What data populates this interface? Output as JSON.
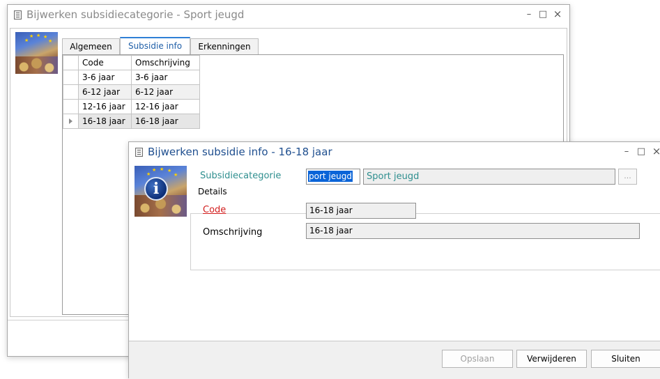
{
  "back_window": {
    "title": "Bijwerken subsidiecategorie - Sport jeugd",
    "tabs": [
      {
        "label": "Algemeen"
      },
      {
        "label": "Subsidie info"
      },
      {
        "label": "Erkenningen"
      }
    ],
    "grid": {
      "headers": [
        "Code",
        "Omschrijving"
      ],
      "rows": [
        {
          "code": "3-6 jaar",
          "omschrijving": "3-6 jaar"
        },
        {
          "code": "6-12 jaar",
          "omschrijving": "6-12 jaar"
        },
        {
          "code": "12-16 jaar",
          "omschrijving": "12-16 jaar"
        },
        {
          "code": "16-18 jaar",
          "omschrijving": "16-18 jaar"
        }
      ]
    }
  },
  "front_window": {
    "title": "Bijwerken subsidie info - 16-18 jaar",
    "subsidiecategorie_label": "Subsidiecategorie",
    "subsidiecategorie_code": "port jeugd",
    "subsidiecategorie_name": "Sport jeugd",
    "ellipsis": "...",
    "details_label": "Details",
    "code_label": "Code",
    "code_value": "16-18 jaar",
    "omschrijving_label": "Omschrijving",
    "omschrijving_value": "16-18 jaar",
    "buttons": {
      "save": "Opslaan",
      "delete": "Verwijderen",
      "close": "Sluiten"
    }
  },
  "window_controls": {
    "minimize": "–",
    "maximize": "□",
    "close": "×"
  },
  "colors": {
    "accent": "#2f7fd6",
    "teal_label": "#2f8f8f",
    "required_link": "#d21e1e",
    "selection": "#0a64d8"
  },
  "icons": [
    "form-icon",
    "subsidy-thumbnail",
    "info-icon",
    "row-indicator-icon"
  ]
}
